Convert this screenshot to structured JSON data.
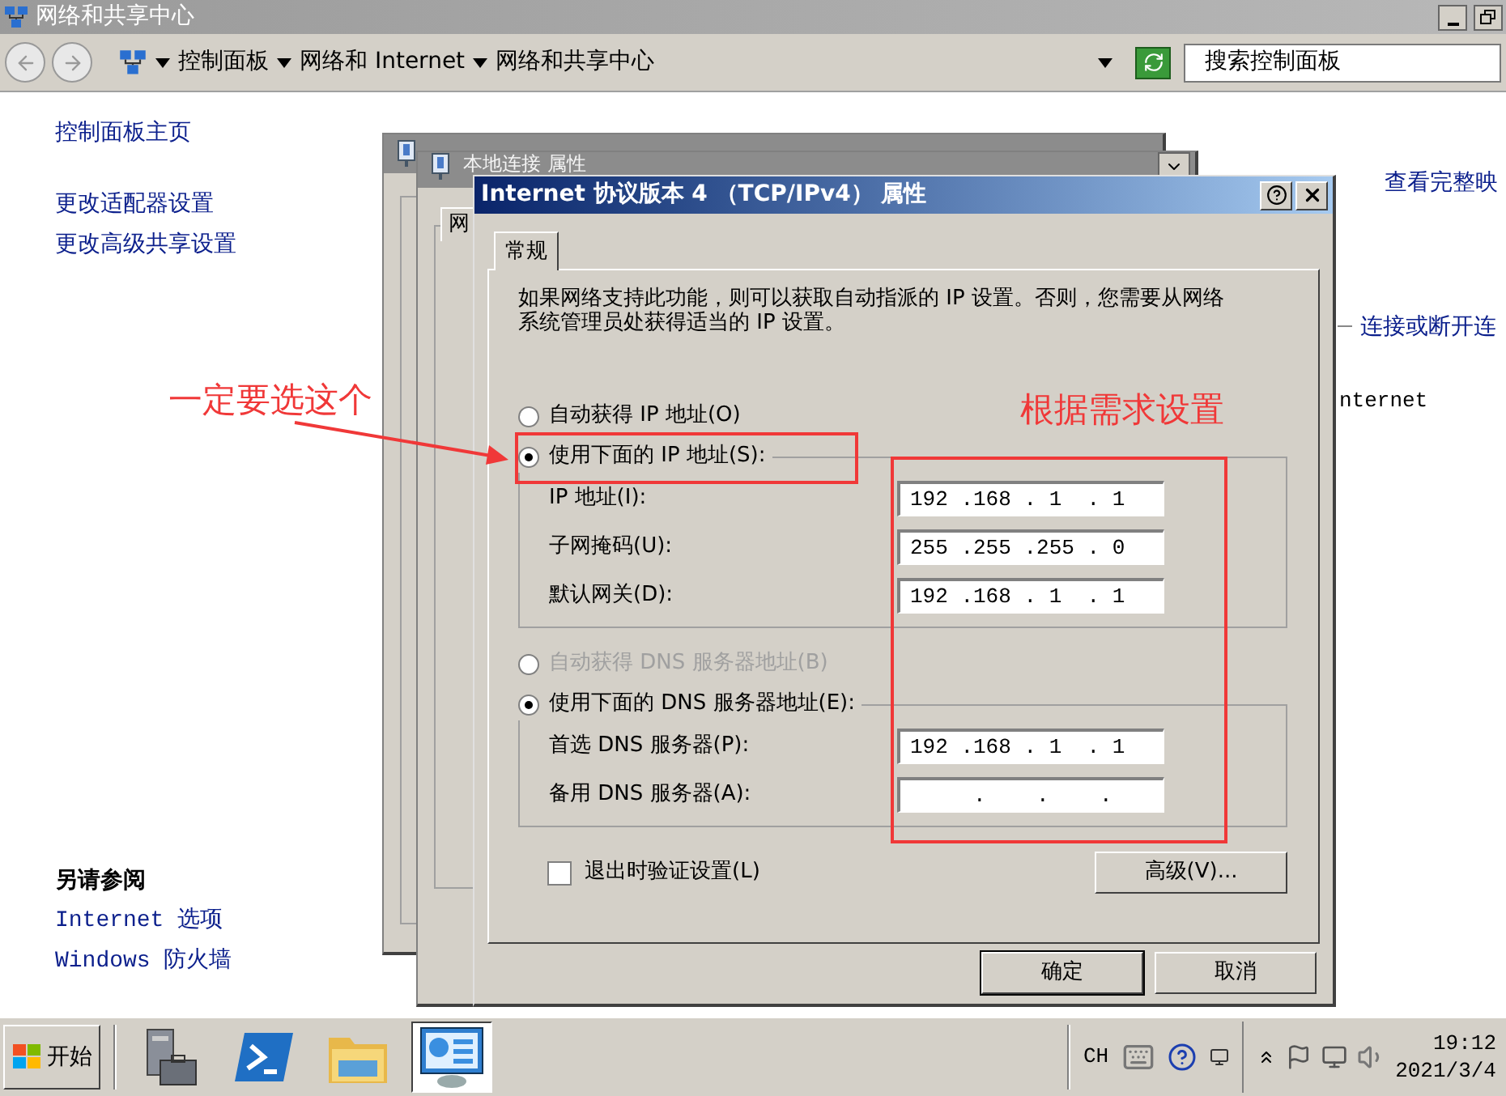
{
  "window": {
    "title": "网络和共享中心"
  },
  "breadcrumb": [
    "控制面板",
    "网络和 Internet",
    "网络和共享中心"
  ],
  "search": {
    "placeholder": "搜索控制面板"
  },
  "sidebar": {
    "links": [
      "控制面板主页",
      "更改适配器设置",
      "更改高级共享设置"
    ],
    "see_also_title": "另请参阅",
    "see_also": [
      "Internet 选项",
      "Windows 防火墙"
    ]
  },
  "content_fragments": [
    {
      "kind": "link",
      "text": "查看完整映"
    },
    {
      "kind": "task",
      "text": "连接或断开连"
    },
    {
      "kind": "plain",
      "text": "nternet"
    }
  ],
  "background_window": {
    "title": "本地连接 属性",
    "tab": "网"
  },
  "dialog": {
    "title": "Internet 协议版本 4 （TCP/IPv4） 属性",
    "tabs": [
      {
        "label": "常规",
        "selected": true
      }
    ],
    "description": "如果网络支持此功能，则可以获取自动指派的 IP 设置。否则，您需要从网络系统管理员处获得适当的 IP 设置。",
    "ip_mode": [
      {
        "label": "自动获得 IP 地址(O)",
        "selected": false,
        "disabled": false
      },
      {
        "label": "使用下面的 IP 地址(S):",
        "selected": true,
        "disabled": false
      }
    ],
    "ip_fields": [
      {
        "label": "IP 地址(I):",
        "value": "192 .168 . 1  . 1"
      },
      {
        "label": "子网掩码(U):",
        "value": "255 .255 .255 . 0"
      },
      {
        "label": "默认网关(D):",
        "value": "192 .168 . 1  . 1"
      }
    ],
    "dns_mode": [
      {
        "label": "自动获得 DNS 服务器地址(B)",
        "selected": false,
        "disabled": true
      },
      {
        "label": "使用下面的 DNS 服务器地址(E):",
        "selected": true,
        "disabled": false
      }
    ],
    "dns_fields": [
      {
        "label": "首选 DNS 服务器(P):",
        "value": "192 .168 . 1  . 1"
      },
      {
        "label": "备用 DNS 服务器(A):",
        "value": "     .    .    ."
      }
    ],
    "validate": {
      "label": "退出时验证设置(L)",
      "checked": false
    },
    "advanced_button": "高级(V)...",
    "buttons": [
      "确定",
      "取消"
    ]
  },
  "annotations": [
    {
      "kind": "arrow-note",
      "text": "一定要选这个"
    },
    {
      "kind": "box-note",
      "text": "根据需求设置"
    }
  ],
  "taskbar": {
    "start": "开始",
    "apps": [
      {
        "kind": "server",
        "selected": false
      },
      {
        "kind": "shell",
        "selected": false
      },
      {
        "kind": "folder",
        "selected": false
      },
      {
        "kind": "panel",
        "selected": true
      }
    ],
    "language": "CH",
    "time": "19:12",
    "date": "2021/3/4"
  }
}
